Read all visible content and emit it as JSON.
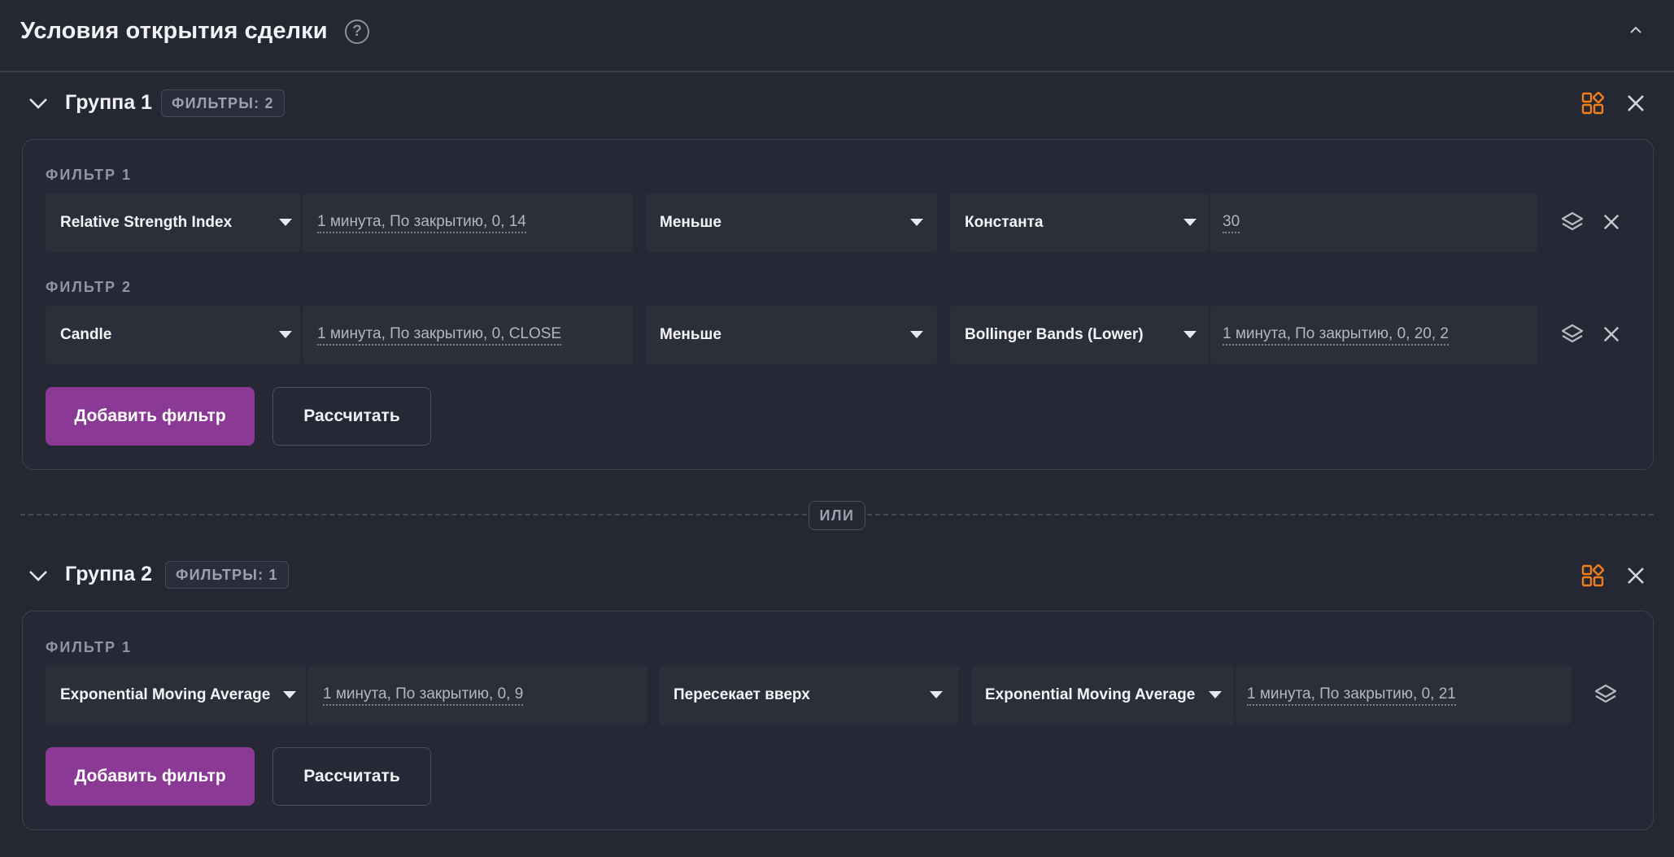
{
  "header": {
    "title": "Условия открытия сделки",
    "help_glyph": "?"
  },
  "or_label": "ИЛИ",
  "colors": {
    "accent": "#8a3a94",
    "orange": "#f07f1a",
    "bg": "#252733"
  },
  "groups": [
    {
      "title": "Группа 1",
      "badge": "ФИЛЬТРЫ: 2",
      "add_button": "Добавить фильтр",
      "calc_button": "Рассчитать",
      "filters": [
        {
          "label": "ФИЛЬТР 1",
          "indicator": "Relative Strength Index",
          "params": "1 минута, По закрытию, 0, 14",
          "operator": "Меньше",
          "target": "Константа",
          "target_params": "30"
        },
        {
          "label": "ФИЛЬТР 2",
          "indicator": "Candle",
          "params": "1 минута, По закрытию, 0, CLOSE",
          "operator": "Меньше",
          "target": "Bollinger Bands (Lower)",
          "target_params": "1 минута, По закрытию, 0, 20, 2"
        }
      ]
    },
    {
      "title": "Группа 2",
      "badge": "ФИЛЬТРЫ: 1",
      "add_button": "Добавить фильтр",
      "calc_button": "Рассчитать",
      "filters": [
        {
          "label": "ФИЛЬТР 1",
          "indicator": "Exponential Moving Average",
          "params": "1 минута, По закрытию, 0, 9",
          "operator": "Пересекает вверх",
          "target": "Exponential Moving Average",
          "target_params": "1 минута, По закрытию, 0, 21"
        }
      ]
    }
  ]
}
